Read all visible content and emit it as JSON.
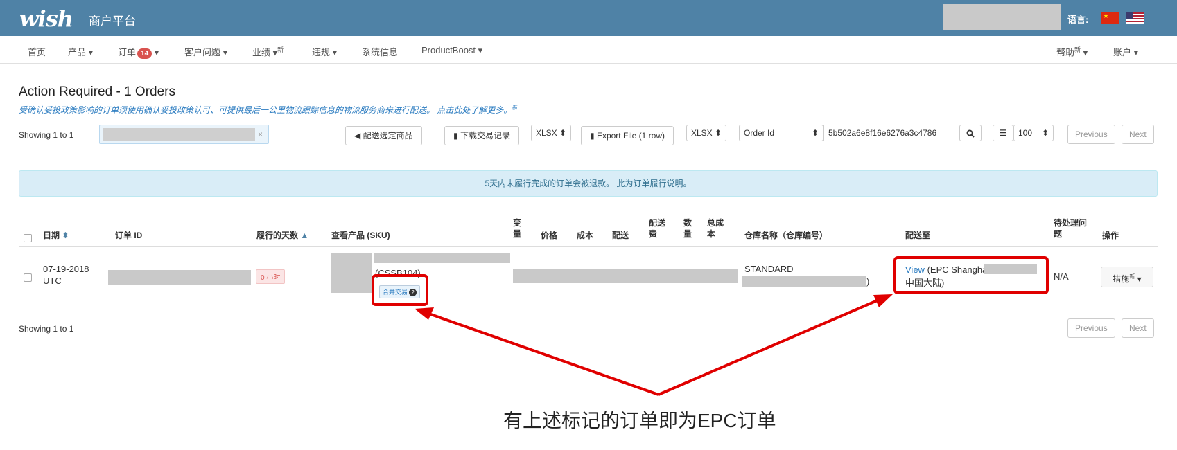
{
  "header": {
    "logo": "wish",
    "platform": "商户平台",
    "lang_label": "语言:"
  },
  "nav": {
    "items": [
      {
        "label": "首页"
      },
      {
        "label": "产品 ▾"
      },
      {
        "label": "订单",
        "badge": "14",
        "suffix": "▾"
      },
      {
        "label": "客户问题 ▾"
      },
      {
        "label": "业绩 ▾",
        "sup": "新"
      },
      {
        "label": "违规 ▾"
      },
      {
        "label": "系统信息"
      },
      {
        "label": "ProductBoost ▾"
      }
    ],
    "help": "帮助",
    "help_sup": "新",
    "help_suffix": "▾",
    "account": "账户 ▾"
  },
  "page": {
    "title": "Action Required - 1 Orders",
    "notice": "受确认妥投政策影响的订单须使用确认妥投政策认可、可提供最后一公里物流跟踪信息的物流服务商来进行配送。 点击此处了解更多。",
    "notice_sup": "新"
  },
  "toolbar": {
    "showing": "Showing 1 to 1",
    "filter_clear": "×",
    "ship_btn": "配送选定商品",
    "download_btn": "下载交易记录",
    "download_format": "XLSX ⬍",
    "export_btn": "Export File (1 row)",
    "export_format": "XLSX ⬍",
    "search_field": "Order Id",
    "search_field_arrow": "⬍",
    "search_value": "5b502a6e8f16e6276a3c4786",
    "page_size": "100",
    "page_size_arrow": "⬍",
    "prev": "Previous",
    "next": "Next"
  },
  "alert": "5天内未履行完成的订单会被退款。 此为订单履行说明。",
  "table": {
    "headers": {
      "date": "日期",
      "date_sort": "⬍",
      "order_id": "订单 ID",
      "days": "履行的天数",
      "days_sort": "▲",
      "product": "查看产品 (SKU)",
      "variant": "变量",
      "price": "价格",
      "cost": "成本",
      "shipping": "配送",
      "shipping_fee": "配送费",
      "quantity": "数量",
      "total_cost": "总成本",
      "warehouse": "仓库名称（仓库编号）",
      "ship_to": "配送至",
      "pending": "待处理问题",
      "actions": "操作"
    },
    "row": {
      "date": "07-19-2018",
      "tz": "UTC",
      "hours": "0 小时",
      "sku": "(CSSB104)",
      "merge_tag": "合并交易",
      "warehouse": "STANDARD",
      "warehouse_tail": ")",
      "ship_link": "View",
      "ship_text": "(EPC Shanghai -",
      "ship_text2": "中国大陆)",
      "pending": "N/A",
      "action": "措施",
      "action_sup": "新",
      "action_arrow": "▾"
    }
  },
  "footer": {
    "showing": "Showing 1 to 1",
    "prev": "Previous",
    "next": "Next"
  },
  "annotation": {
    "caption": "有上述标记的订单即为EPC订单",
    "color": "#e00000"
  }
}
